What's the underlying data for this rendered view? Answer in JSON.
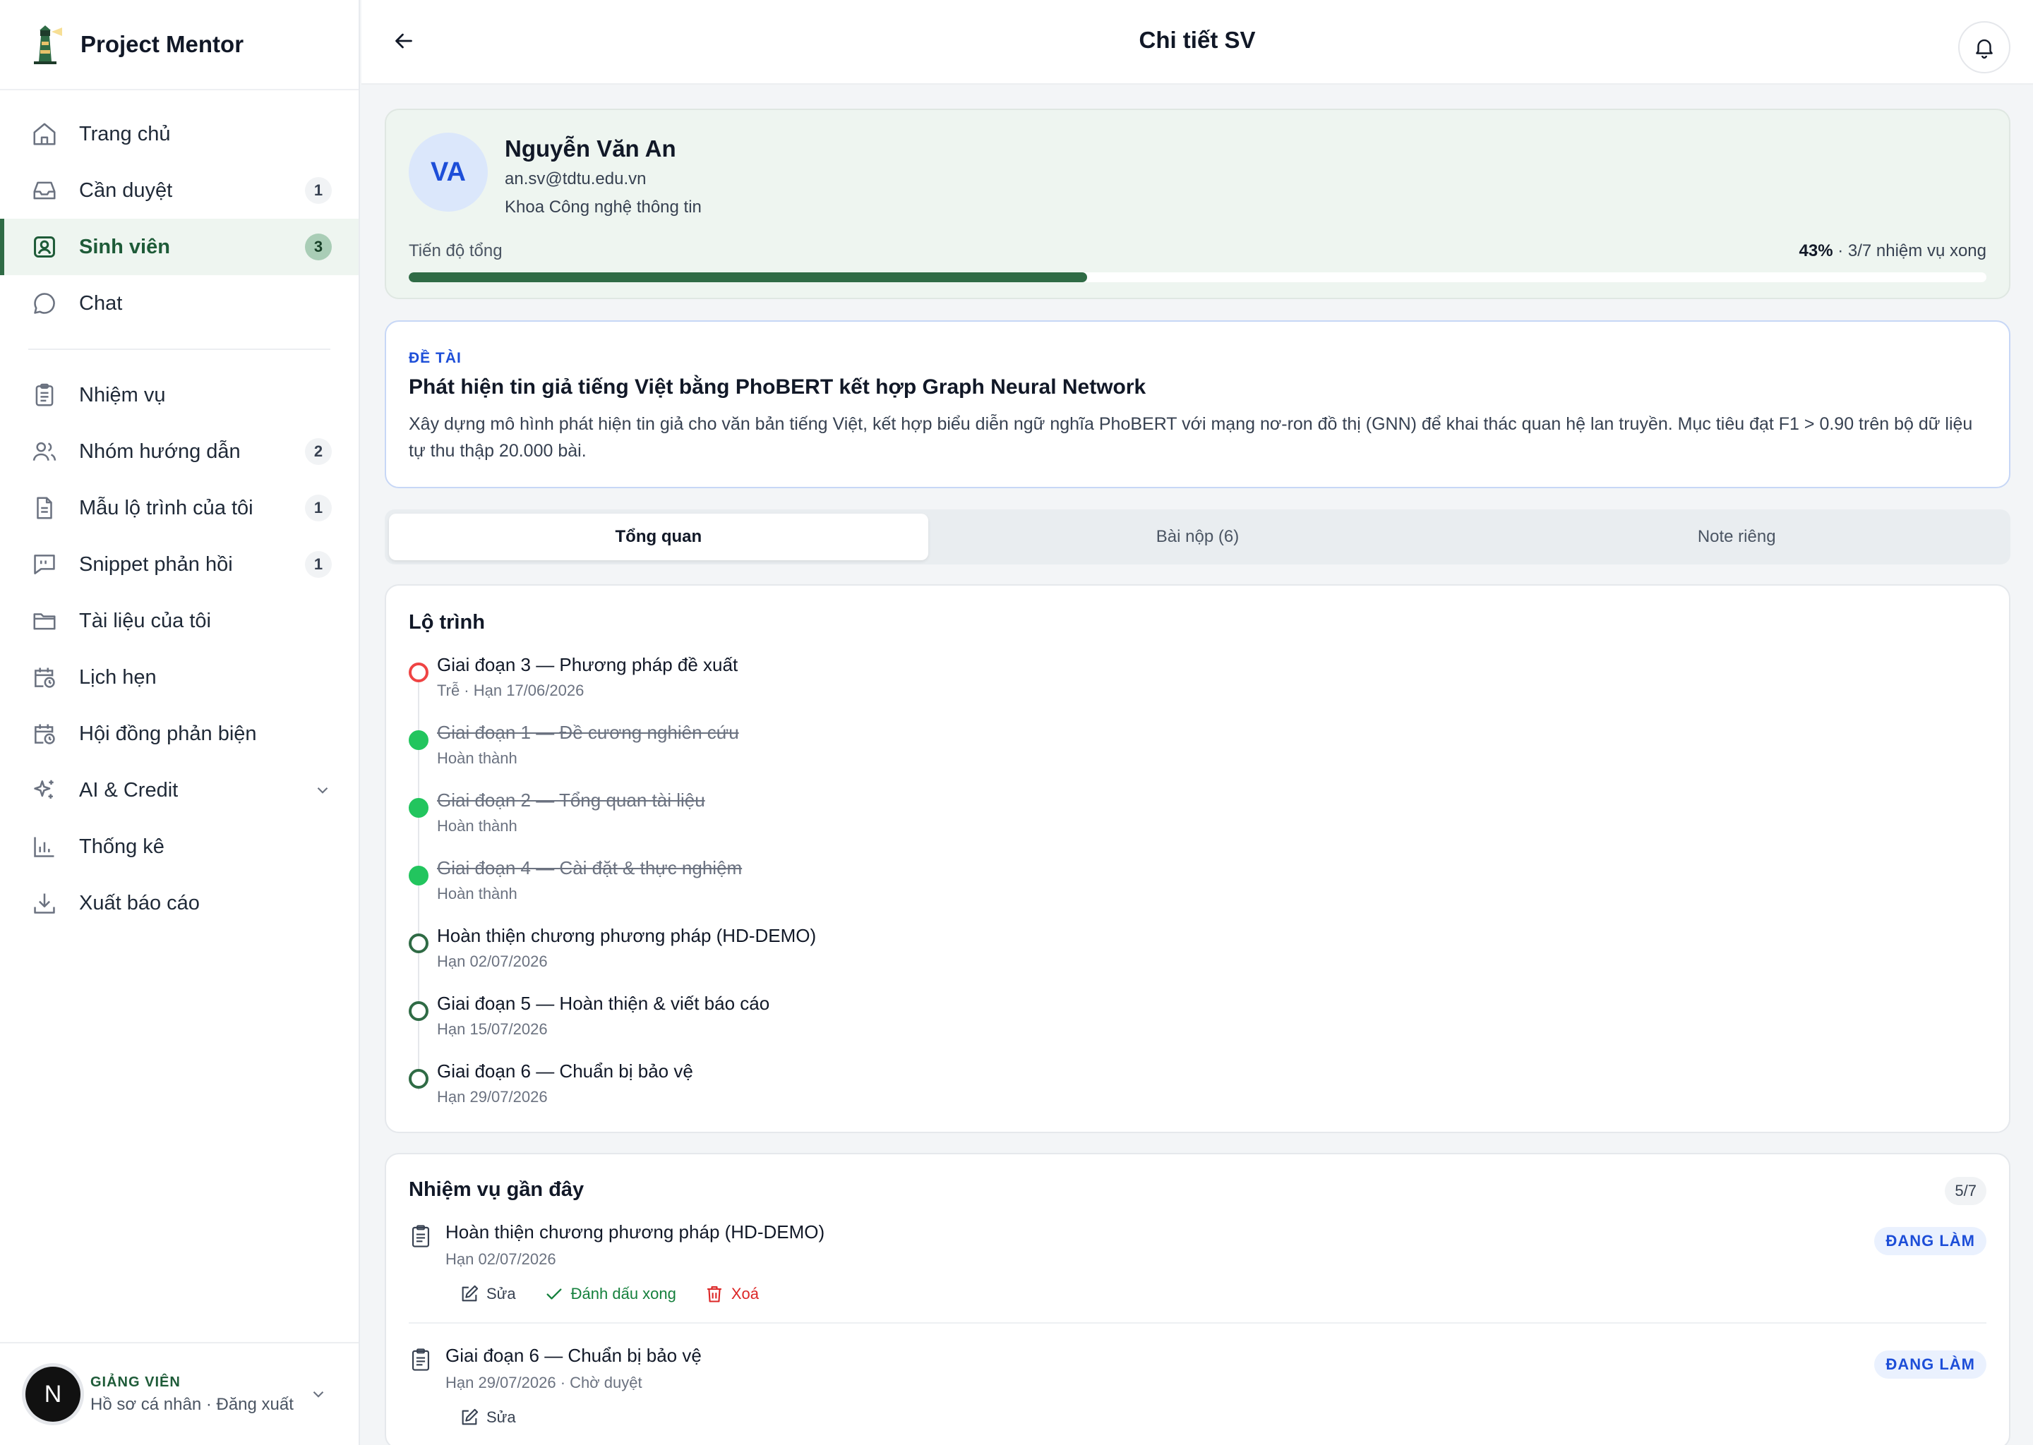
{
  "app": {
    "name": "Project Mentor"
  },
  "sidebar": {
    "items": [
      {
        "label": "Trang chủ",
        "badge": ""
      },
      {
        "label": "Cần duyệt",
        "badge": "1"
      },
      {
        "label": "Sinh viên",
        "badge": "3"
      },
      {
        "label": "Chat",
        "badge": ""
      },
      {
        "label": "Nhiệm vụ",
        "badge": ""
      },
      {
        "label": "Nhóm hướng dẫn",
        "badge": "2"
      },
      {
        "label": "Mẫu lộ trình của tôi",
        "badge": "1"
      },
      {
        "label": "Snippet phản hồi",
        "badge": "1"
      },
      {
        "label": "Tài liệu của tôi",
        "badge": ""
      },
      {
        "label": "Lịch hẹn",
        "badge": ""
      },
      {
        "label": "Hội đồng phản biện",
        "badge": ""
      },
      {
        "label": "AI & Credit",
        "badge": ""
      },
      {
        "label": "Thống kê",
        "badge": ""
      },
      {
        "label": "Xuất báo cáo",
        "badge": ""
      }
    ],
    "user": {
      "initial": "N",
      "role": "GIẢNG VIÊN",
      "links": "Hồ sơ cá nhân · Đăng xuất"
    }
  },
  "topbar": {
    "title": "Chi tiết SV"
  },
  "student": {
    "initials": "VA",
    "name": "Nguyễn Văn An",
    "email": "an.sv@tdtu.edu.vn",
    "department": "Khoa Công nghệ thông tin",
    "progress_label": "Tiến độ tổng",
    "progress_percent_text": "43%",
    "progress_detail": " · 3/7 nhiệm vụ xong",
    "progress_value": 0.43
  },
  "topic": {
    "tag": "ĐỀ TÀI",
    "title": "Phát hiện tin giả tiếng Việt bằng PhoBERT kết hợp Graph Neural Network",
    "description": "Xây dựng mô hình phát hiện tin giả cho văn bản tiếng Việt, kết hợp biểu diễn ngữ nghĩa PhoBERT với mạng nơ-ron đồ thị (GNN) để khai thác quan hệ lan truyền. Mục tiêu đạt F1 > 0.90 trên bộ dữ liệu tự thu thập 20.000 bài."
  },
  "tabs": [
    {
      "label": "Tổng quan",
      "active": true
    },
    {
      "label": "Bài nộp (6)",
      "active": false
    },
    {
      "label": "Note riêng",
      "active": false
    }
  ],
  "roadmap": {
    "title": "Lộ trình",
    "items": [
      {
        "title": "Giai đoạn 3 — Phương pháp đề xuất",
        "sub": "Trễ · Hạn 17/06/2026",
        "status": "late"
      },
      {
        "title": "Giai đoạn 1 — Đề cương nghiên cứu",
        "sub": "Hoàn thành",
        "status": "done"
      },
      {
        "title": "Giai đoạn 2 — Tổng quan tài liệu",
        "sub": "Hoàn thành",
        "status": "done"
      },
      {
        "title": "Giai đoạn 4 — Cài đặt & thực nghiệm",
        "sub": "Hoàn thành",
        "status": "done"
      },
      {
        "title": "Hoàn thiện chương phương pháp (HD-DEMO)",
        "sub": "Hạn 02/07/2026",
        "status": "pending"
      },
      {
        "title": "Giai đoạn 5 — Hoàn thiện & viết báo cáo",
        "sub": "Hạn 15/07/2026",
        "status": "pending"
      },
      {
        "title": "Giai đoạn 6 — Chuẩn bị bảo vệ",
        "sub": "Hạn 29/07/2026",
        "status": "pending"
      }
    ]
  },
  "tasks": {
    "title": "Nhiệm vụ gần đây",
    "count": "5/7",
    "items": [
      {
        "title": "Hoàn thiện chương phương pháp (HD-DEMO)",
        "sub": "Hạn 02/07/2026",
        "status": "ĐANG LÀM"
      },
      {
        "title": "Giai đoạn 6 — Chuẩn bị bảo vệ",
        "sub": "Hạn 29/07/2026 · Chờ duyệt",
        "status": "ĐANG LÀM"
      }
    ],
    "actions": {
      "edit": "Sửa",
      "mark_done": "Đánh dấu xong",
      "delete": "Xoá"
    }
  },
  "colors": {
    "brand": "#2f6b45",
    "accent_blue": "#1d4ed8",
    "late": "#ef4444",
    "done": "#22c55e"
  }
}
